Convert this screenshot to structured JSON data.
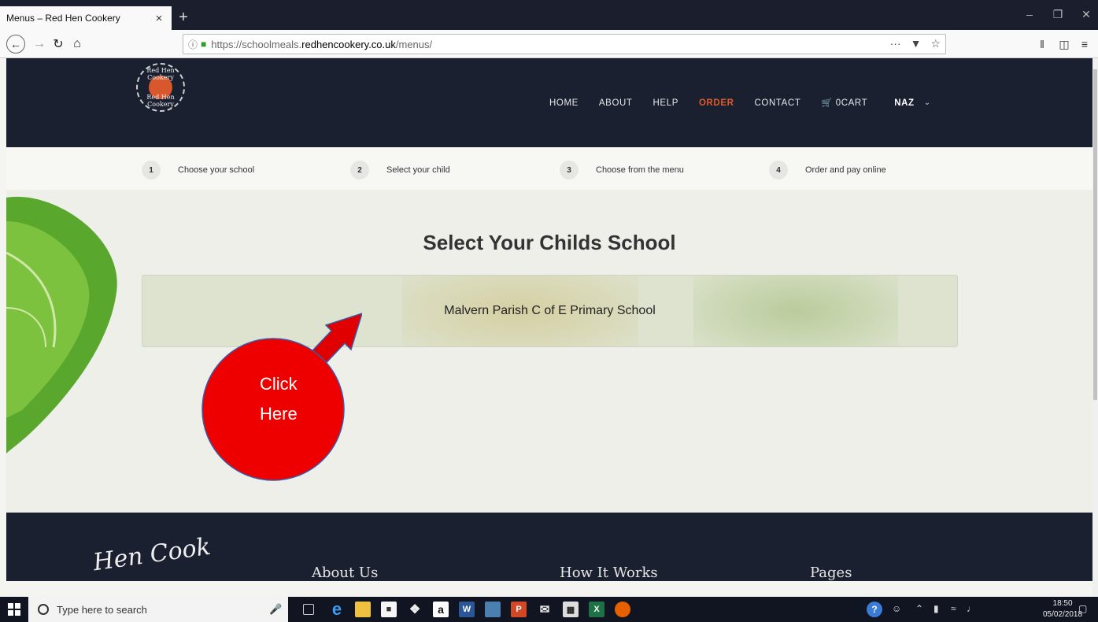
{
  "browser": {
    "tab_title": "Menus – Red Hen Cookery",
    "tab_close": "×",
    "new_tab": "+",
    "url_prefix": "https://schoolmeals.",
    "url_domain": "redhencookery.co.uk",
    "url_suffix": "/menus/",
    "url_more": "···"
  },
  "site": {
    "logo_top": "Red Hen Cookery",
    "logo_bottom": "Red Hen Cookery",
    "nav": {
      "home": "HOME",
      "about": "ABOUT",
      "help": "HELP",
      "order": "ORDER",
      "contact": "CONTACT",
      "cart": "0CART",
      "user": "NAZ"
    },
    "accent_color": "#e05a2a",
    "header_color": "#1a2030"
  },
  "steps": [
    {
      "num": "1",
      "label": "Choose your school"
    },
    {
      "num": "2",
      "label": "Select your child"
    },
    {
      "num": "3",
      "label": "Choose from the menu"
    },
    {
      "num": "4",
      "label": "Order and pay online"
    }
  ],
  "main": {
    "title": "Select Your Childs School",
    "school": "Malvern Parish C of E Primary School"
  },
  "annotation": {
    "line1": "Click",
    "line2": "Here",
    "color": "#ee0000"
  },
  "footer": {
    "logo": "Hen Cook",
    "col1": "About Us",
    "col2": "How It Works",
    "col3": "Pages"
  },
  "taskbar": {
    "search_placeholder": "Type here to search",
    "time": "18:50",
    "date": "05/02/2018"
  }
}
